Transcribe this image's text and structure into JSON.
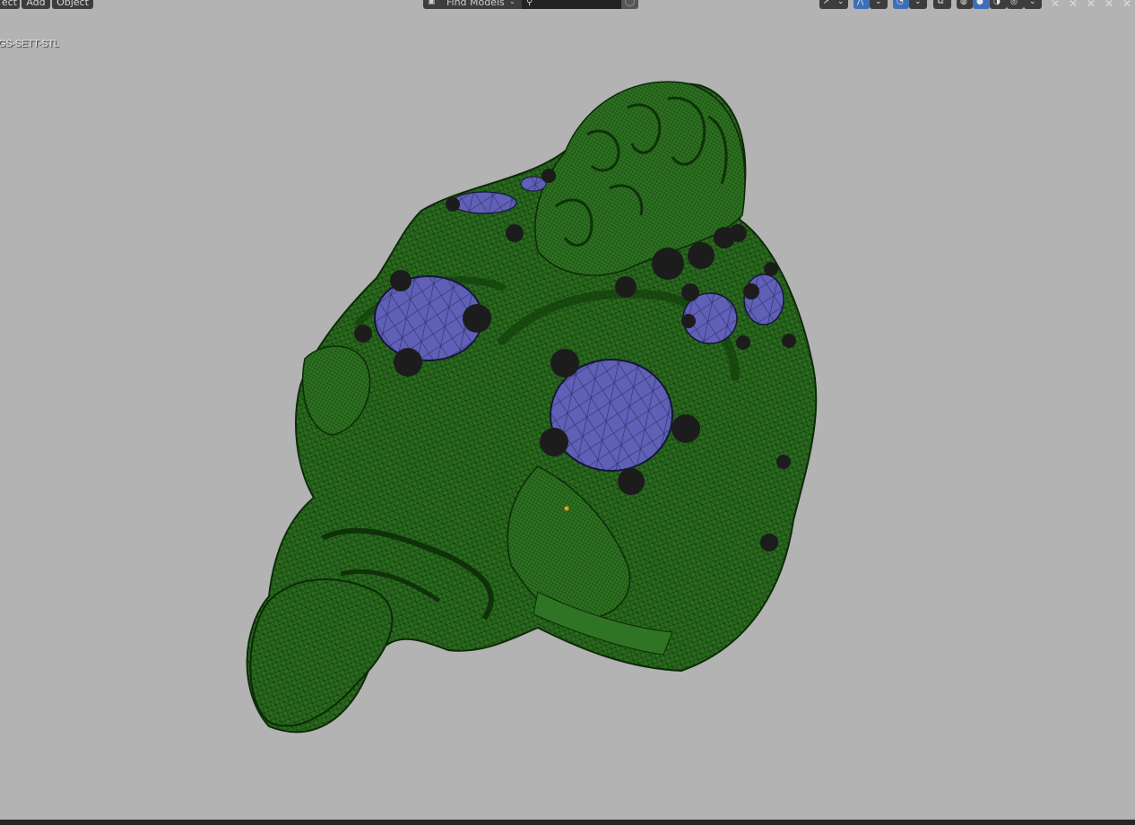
{
  "header": {
    "menu": [
      {
        "label": "ect"
      },
      {
        "label": "Add"
      },
      {
        "label": "Object"
      }
    ],
    "find": {
      "label": "Find Models",
      "icon": "box-icon"
    },
    "search": {
      "value": "",
      "placeholder": ""
    },
    "toolbar_icons": [
      "select-tool-icon",
      "gizmo-icon",
      "overlay-icon",
      "xray-icon",
      "wireframe-shading-icon",
      "solid-shading-icon",
      "material-shading-icon",
      "rendered-shading-icon"
    ],
    "window_controls": [
      "close-icon",
      "close-icon",
      "close-icon",
      "close-icon",
      "close-icon"
    ]
  },
  "viewport": {
    "object_name": "GS-SETT-STL",
    "background_color": "#b3b3b3",
    "mesh_color": "#2a6a1e",
    "gem_color": "#5e5fb3",
    "bead_color": "#1d1d1d",
    "origin_color": "#f29a1a"
  }
}
